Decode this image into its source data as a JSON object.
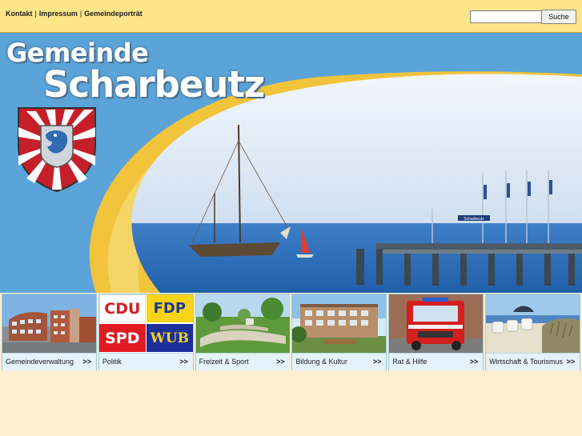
{
  "header": {
    "links": [
      "Kontakt",
      "Impressum",
      "Gemeindeporträt"
    ],
    "separator": "|",
    "search": {
      "value": "",
      "button_label": "Suche"
    }
  },
  "banner": {
    "title_line1": "Gemeinde",
    "title_line2": "Scharbeutz",
    "pier_sign": "Scharbeutz"
  },
  "tiles": [
    {
      "label": "Gemeindeverwaltung",
      "arrow": ">>"
    },
    {
      "label": "Politik",
      "arrow": ">>",
      "parties": [
        "CDU",
        "FDP",
        "SPD",
        "WUB"
      ]
    },
    {
      "label": "Freizeit & Sport",
      "arrow": ">>"
    },
    {
      "label": "Bildung & Kultur",
      "arrow": ">>"
    },
    {
      "label": "Rat & Hilfe",
      "arrow": ">>"
    },
    {
      "label": "Wirtschaft & Tourismus",
      "arrow": ">>"
    }
  ],
  "colors": {
    "topbar": "#fde58a",
    "banner_sky": "#5ba4d9",
    "tile_label_bg": "#e4f3fa",
    "page_bg": "#fdf0d0"
  }
}
